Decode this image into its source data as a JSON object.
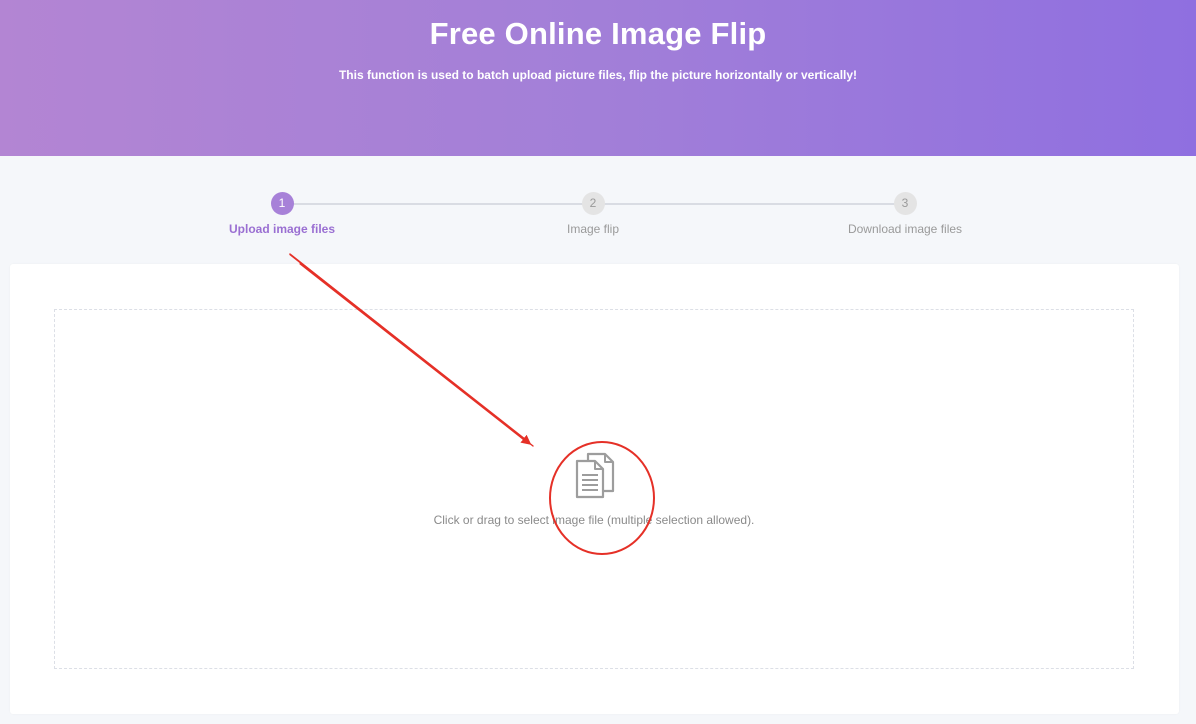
{
  "hero": {
    "title": "Free Online Image Flip",
    "subtitle": "This function is used to batch upload picture files, flip the picture horizontally or vertically!"
  },
  "steps": [
    {
      "number": "1",
      "label": "Upload image files",
      "active": true
    },
    {
      "number": "2",
      "label": "Image flip",
      "active": false
    },
    {
      "number": "3",
      "label": "Download image files",
      "active": false
    }
  ],
  "upload": {
    "prompt": "Click or drag to select image file (multiple selection allowed).",
    "icon": "document-stack-icon"
  },
  "colors": {
    "hero_start": "#b385d3",
    "hero_end": "#8f6fe0",
    "accent": "#a781d8",
    "annotation": "#e53027"
  }
}
